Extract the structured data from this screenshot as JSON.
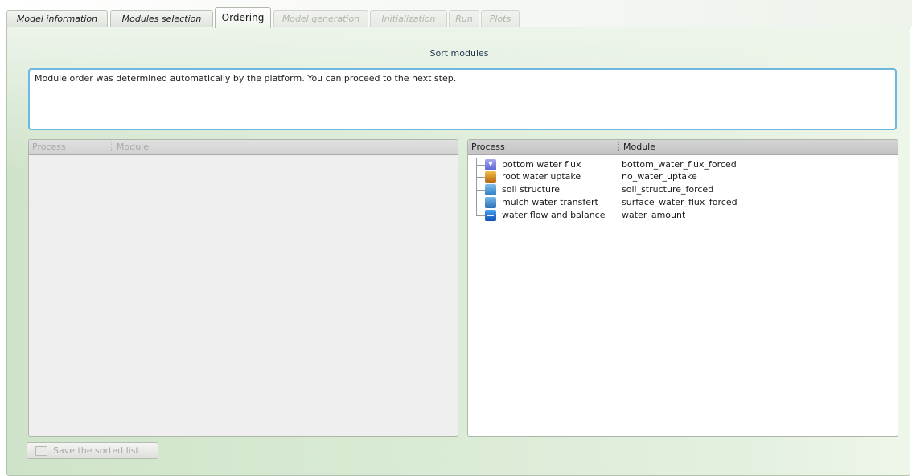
{
  "tabs": [
    {
      "label": "Model information",
      "state": "normal"
    },
    {
      "label": "Modules selection",
      "state": "normal"
    },
    {
      "label": "Ordering",
      "state": "active"
    },
    {
      "label": "Model generation",
      "state": "disabled"
    },
    {
      "label": "Initialization",
      "state": "disabled"
    },
    {
      "label": "Run",
      "state": "disabled"
    },
    {
      "label": "Plots",
      "state": "disabled"
    }
  ],
  "ordering": {
    "title": "Sort modules",
    "message": "Module order was determined automatically by the platform.  You can proceed to the next step.",
    "left_list": {
      "col_process": "Process",
      "col_module": "Module",
      "rows": []
    },
    "right_list": {
      "col_process": "Process",
      "col_module": "Module",
      "rows": [
        {
          "process": "bottom water flux",
          "module": "bottom_water_flux_forced",
          "icon": "bottom-water-flux-icon"
        },
        {
          "process": "root water uptake",
          "module": "no_water_uptake",
          "icon": "root-water-uptake-icon"
        },
        {
          "process": "soil structure",
          "module": "soil_structure_forced",
          "icon": "soil-structure-icon"
        },
        {
          "process": "mulch water transfert",
          "module": "surface_water_flux_forced",
          "icon": "mulch-water-transfert-icon"
        },
        {
          "process": "water flow and balance",
          "module": "water_amount",
          "icon": "water-flow-balance-icon"
        }
      ]
    },
    "save_button": {
      "label": "Save the sorted list",
      "enabled": false
    }
  },
  "colors": {
    "panel_green": "#d8ead3",
    "message_border": "#6fb7dd",
    "title_text": "#233b52"
  }
}
